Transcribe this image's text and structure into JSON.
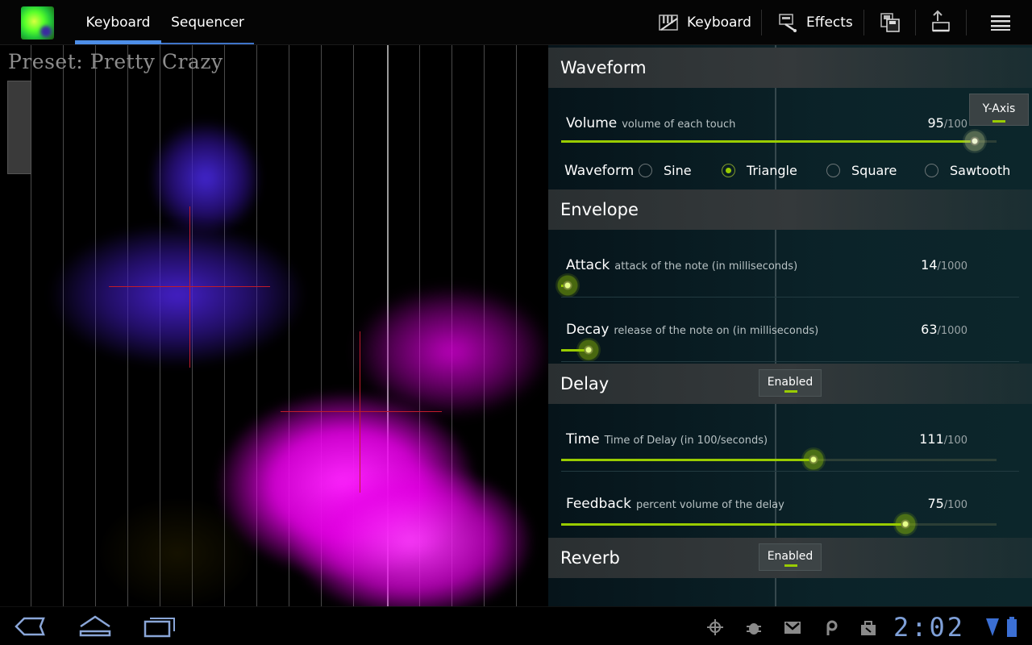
{
  "actionbar": {
    "tabs": [
      {
        "label": "Keyboard",
        "selected": true
      },
      {
        "label": "Sequencer",
        "selected": false
      }
    ],
    "actions": {
      "keyboard_label": "Keyboard",
      "effects_label": "Effects"
    },
    "icons": [
      "piano-keys-icon",
      "effects-icon",
      "save-preset-icon",
      "upload-preset-icon",
      "overflow-menu-icon"
    ]
  },
  "visualizer": {
    "preset_text": "Preset: Pretty Crazy"
  },
  "panel": {
    "waveform": {
      "title": "Waveform",
      "yaxis_label": "Y-Axis",
      "volume": {
        "name": "Volume",
        "desc": "volume of each touch",
        "value": "95",
        "max": "/100",
        "fraction": 0.95
      },
      "waveform_label": "Waveform",
      "options": [
        {
          "label": "Sine",
          "selected": false
        },
        {
          "label": "Triangle",
          "selected": true
        },
        {
          "label": "Square",
          "selected": false
        },
        {
          "label": "Sawtooth",
          "selected": false
        }
      ]
    },
    "envelope": {
      "title": "Envelope",
      "attack": {
        "name": "Attack",
        "desc": "attack of the note (in milliseconds)",
        "value": "14",
        "max": "/1000",
        "fraction": 0.014
      },
      "decay": {
        "name": "Decay",
        "desc": "release of the note on (in milliseconds)",
        "value": "63",
        "max": "/1000",
        "fraction": 0.063
      }
    },
    "delay": {
      "title": "Delay",
      "toggle": "Enabled",
      "time": {
        "name": "Time",
        "desc": "Time of Delay (in 100/seconds)",
        "value": "111",
        "max": "/100",
        "fraction": 0.58
      },
      "feedback": {
        "name": "Feedback",
        "desc": "percent volume of the delay",
        "value": "75",
        "max": "/100",
        "fraction": 0.79
      }
    },
    "reverb": {
      "title": "Reverb",
      "toggle": "Enabled"
    }
  },
  "systembar": {
    "clock": "2:02",
    "colors": {
      "clock": "#7fa0d8",
      "accent": "#99cc00",
      "tab_indicator": "#4d8ee8"
    }
  }
}
